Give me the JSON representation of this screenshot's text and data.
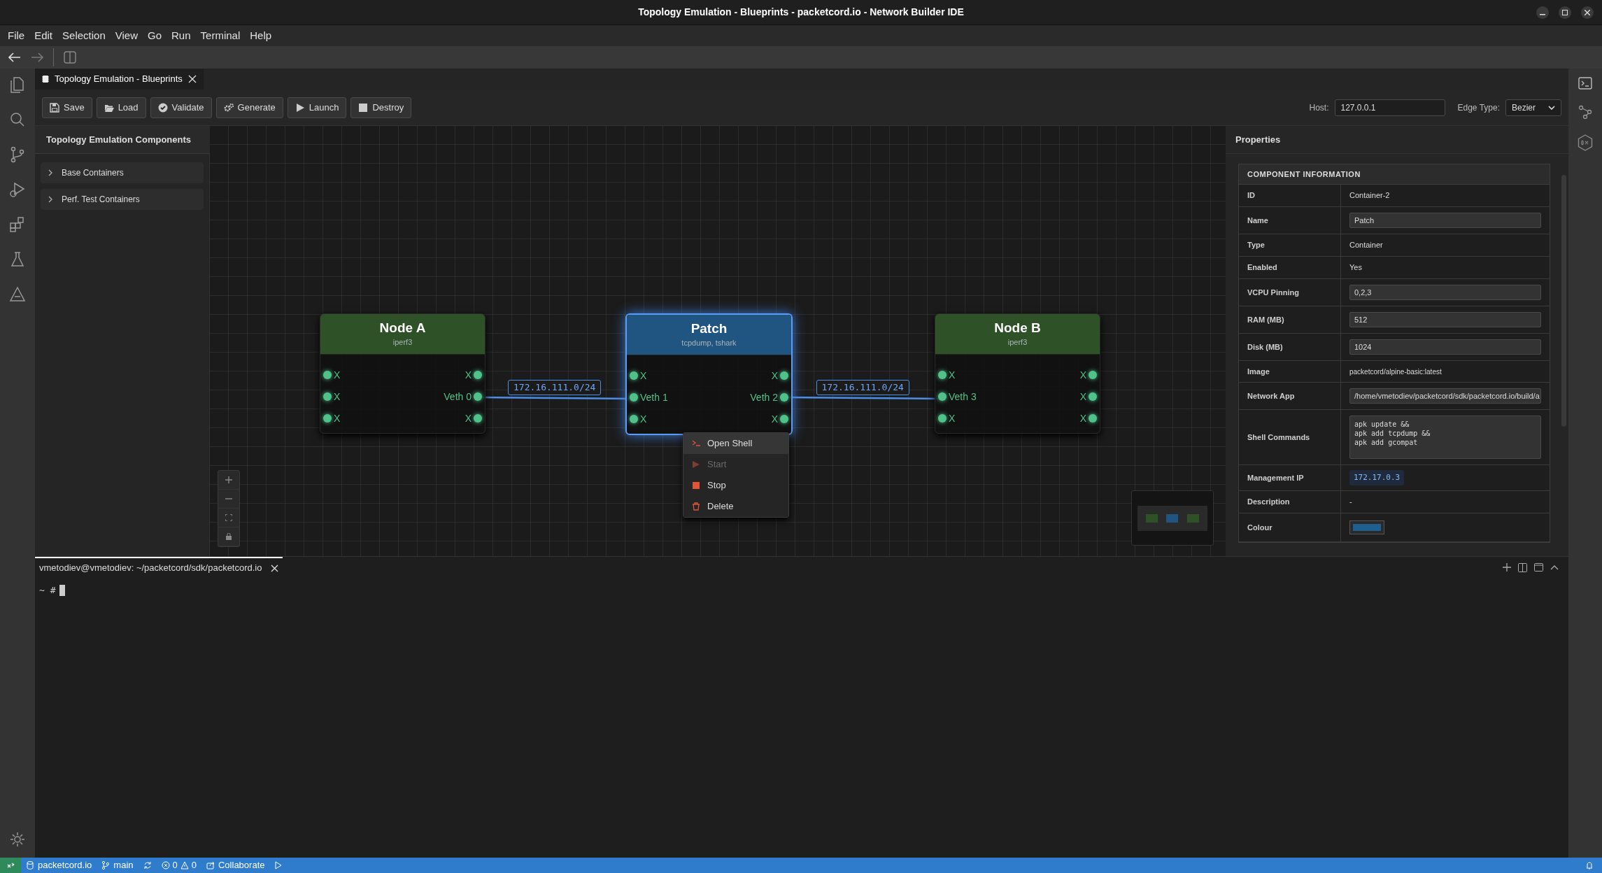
{
  "window": {
    "title": "Topology Emulation - Blueprints - packetcord.io - Network Builder IDE"
  },
  "menu": [
    "File",
    "Edit",
    "Selection",
    "View",
    "Go",
    "Run",
    "Terminal",
    "Help"
  ],
  "editor_tabs": [
    {
      "label": "Topology Emulation - Blueprints",
      "selected": true
    }
  ],
  "toolbar": {
    "buttons": [
      {
        "label": "Save",
        "kind": "save"
      },
      {
        "label": "Load",
        "kind": "load"
      },
      {
        "label": "Validate",
        "kind": "validate"
      },
      {
        "label": "Generate",
        "kind": "generate"
      },
      {
        "label": "Launch",
        "kind": "launch"
      },
      {
        "label": "Destroy",
        "kind": "destroy"
      }
    ],
    "host": {
      "label": "Host:",
      "value": "127.0.0.1"
    },
    "edge_type": {
      "label": "Edge Type:",
      "value": "Bezier"
    }
  },
  "components": {
    "title": "Topology Emulation Components",
    "groups": [
      {
        "label": "Base Containers",
        "expanded": false
      },
      {
        "label": "Perf. Test Containers",
        "expanded": false
      }
    ]
  },
  "canvas": {
    "nodes": [
      {
        "title": "Node A",
        "subtitle": "iperf3",
        "color": "#2f5128",
        "selected": false,
        "left_ports": [
          "X",
          "X",
          "X"
        ],
        "right_ports": [
          "X",
          "Veth 0",
          "X"
        ]
      },
      {
        "title": "Patch",
        "subtitle": "tcpdump, tshark",
        "color": "#1f5580",
        "selected": true,
        "left_ports": [
          "X",
          "Veth 1",
          "X"
        ],
        "right_ports": [
          "X",
          "Veth 2",
          "X"
        ]
      },
      {
        "title": "Node B",
        "subtitle": "iperf3",
        "color": "#2f5128",
        "selected": false,
        "left_ports": [
          "X",
          "Veth 3",
          "X"
        ],
        "right_ports": [
          "X",
          "X",
          "X"
        ]
      }
    ],
    "edges": [
      {
        "label": "172.16.111.0/24"
      },
      {
        "label": "172.16.111.0/24"
      }
    ],
    "context_menu": [
      {
        "label": "Open Shell",
        "kind": "shell",
        "disabled": false,
        "selected": true
      },
      {
        "label": "Start",
        "kind": "start",
        "disabled": true,
        "selected": false
      },
      {
        "label": "Stop",
        "kind": "stop",
        "disabled": false,
        "selected": false
      },
      {
        "label": "Delete",
        "kind": "delete",
        "disabled": false,
        "selected": false
      }
    ]
  },
  "properties": {
    "title": "Properties",
    "section": "COMPONENT INFORMATION",
    "rows": [
      {
        "label": "ID",
        "kind": "text",
        "value": "Container-2"
      },
      {
        "label": "Name",
        "kind": "input",
        "value": "Patch"
      },
      {
        "label": "Type",
        "kind": "text",
        "value": "Container"
      },
      {
        "label": "Enabled",
        "kind": "text",
        "value": "Yes"
      },
      {
        "label": "VCPU Pinning",
        "kind": "input",
        "value": "0,2,3"
      },
      {
        "label": "RAM (MB)",
        "kind": "input",
        "value": "512"
      },
      {
        "label": "Disk (MB)",
        "kind": "input",
        "value": "1024"
      },
      {
        "label": "Image",
        "kind": "small",
        "value": "packetcord/alpine-basic:latest"
      },
      {
        "label": "Network App",
        "kind": "input",
        "value": "/home/vmetodiev/packetcord/sdk/packetcord.io/build/a"
      },
      {
        "label": "Shell Commands",
        "kind": "textarea",
        "value": "apk update &&\napk add tcpdump &&\napk add gcompat"
      },
      {
        "label": "Management IP",
        "kind": "code",
        "value": "172.17.0.3"
      },
      {
        "label": "Description",
        "kind": "text",
        "value": "-"
      },
      {
        "label": "Colour",
        "kind": "swatch",
        "color": "#1f5f8f"
      }
    ]
  },
  "terminal": {
    "tab": "vmetodiev@vmetodiev: ~/packetcord/sdk/packetcord.io",
    "prompt": "~ #"
  },
  "status_bar": {
    "workspace": "packetcord.io",
    "branch": "main",
    "errors": "0",
    "warnings": "0",
    "collaborate": "Collaborate"
  }
}
